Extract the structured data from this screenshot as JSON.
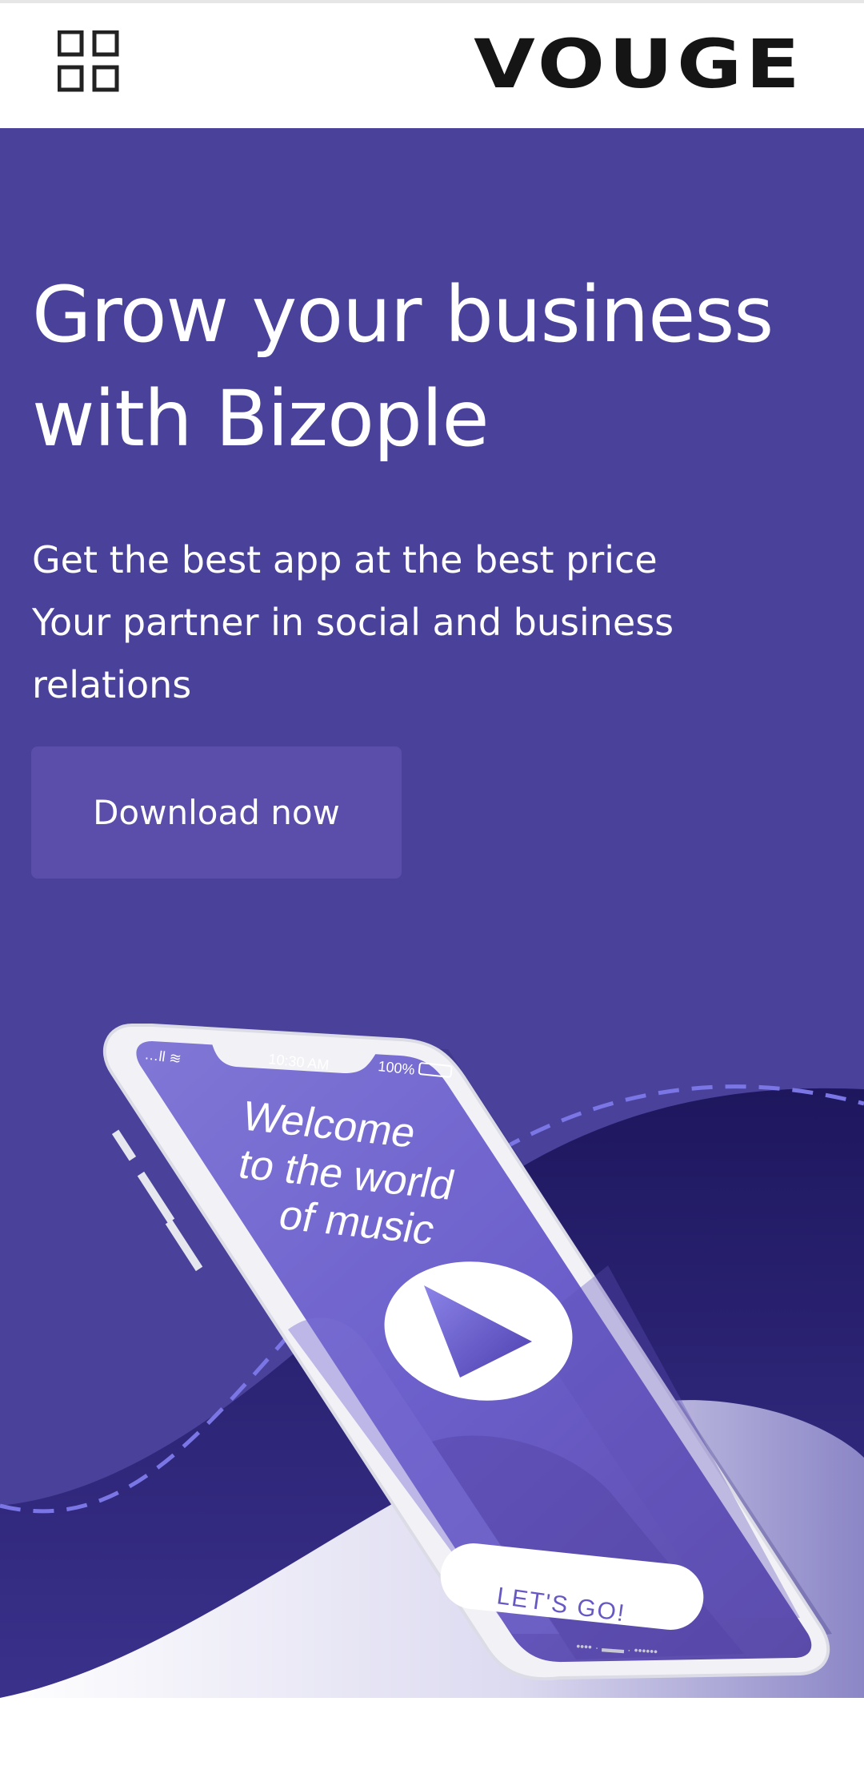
{
  "header": {
    "logo": "VOUGE",
    "menu_icon": "grid-menu-icon"
  },
  "hero": {
    "title_line1": "Grow your business",
    "title_line2": "with Bizople",
    "subtitle_line1": "Get the best app at the best price",
    "subtitle_line2": "Your partner in social and business",
    "subtitle_line3": "relations",
    "cta_label": "Download now"
  },
  "phone": {
    "status_time": "10:30 AM",
    "status_battery": "100%",
    "welcome_line1": "Welcome",
    "welcome_line2": "to the world",
    "welcome_line3": "of music",
    "button_label": "LET'S GO!"
  },
  "colors": {
    "hero_bg": "#4a429a",
    "button_bg": "#5b4daa",
    "wave_dark": "#221c64",
    "dash": "#7b76e6"
  }
}
